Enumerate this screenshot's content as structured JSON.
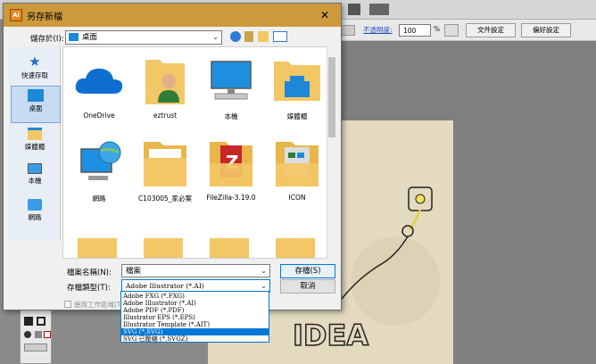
{
  "background_app": {
    "opacity_label": "不透明度:",
    "opacity_value": "100",
    "percent": "%",
    "doc_settings_button": "文件設定",
    "preferences_button": "偏好設定",
    "canvas_text": "IDEA"
  },
  "dialog": {
    "title": "另存新檔",
    "app_icon_text": "Ai",
    "save_in_label": "儲存於(I):",
    "save_in_value": "桌面",
    "places": [
      {
        "label": "快速存取"
      },
      {
        "label": "桌面"
      },
      {
        "label": "媒體櫃"
      },
      {
        "label": "本機"
      },
      {
        "label": "網路"
      }
    ],
    "files": [
      {
        "name": "OneDrive"
      },
      {
        "name": "eztrust"
      },
      {
        "name": "本機"
      },
      {
        "name": "媒體櫃"
      },
      {
        "name": "網路"
      },
      {
        "name": "C103005_家必案"
      },
      {
        "name": "FileZilla-3.19.0"
      },
      {
        "name": "ICON"
      }
    ],
    "filename_label": "檔案名稱(N):",
    "filename_value": "檔案",
    "filetype_label": "存檔類型(T):",
    "filetype_value": "Adobe Illustrator (*.AI)",
    "save_button": "存檔(S)",
    "cancel_button": "取消",
    "artboard_checkbox_label": "使用工作區域(T)",
    "filetype_options": [
      "Adobe FXG (*.FXG)",
      "Adobe Illustrator (*.AI)",
      "Adobe PDF (*.PDF)",
      "Illustrator EPS (*.EPS)",
      "Illustrator Template (*.AIT)",
      "SVG (*.SVG)",
      "SVG 已壓縮 (*.SVGZ)"
    ],
    "selected_option_index": 5
  },
  "colors": {
    "titlebar": "#cc9a3c",
    "selection": "#0078d7",
    "folder": "#f3c765"
  }
}
